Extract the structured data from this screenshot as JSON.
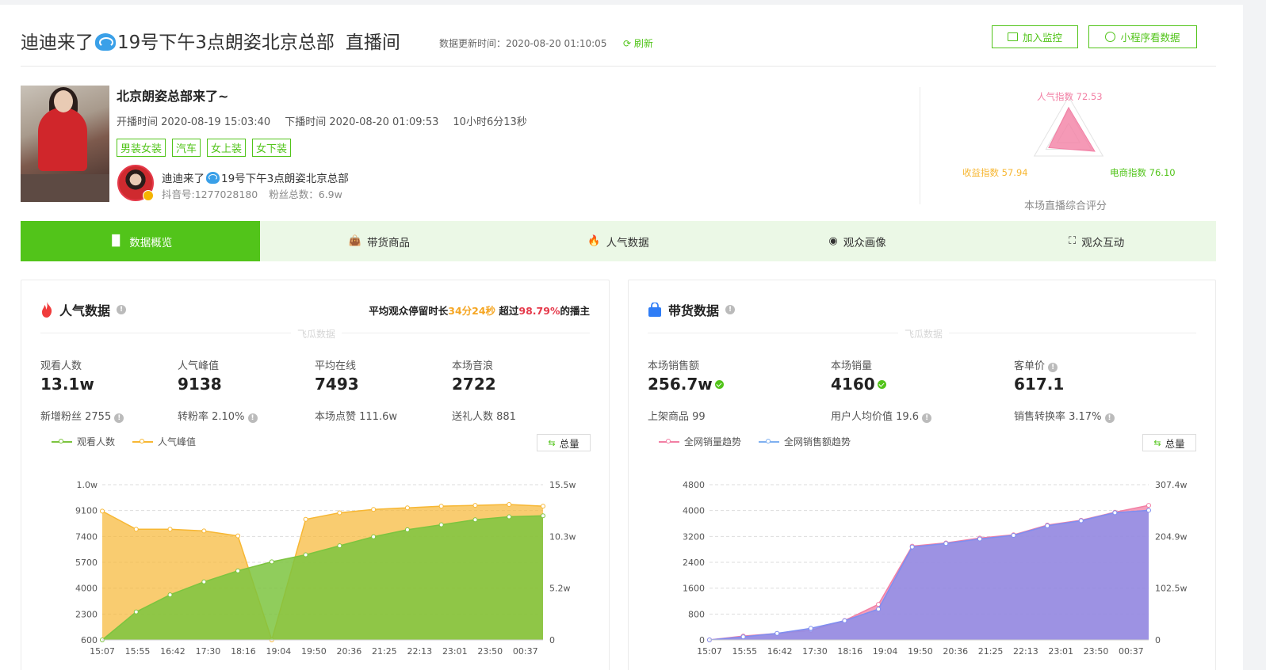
{
  "header": {
    "title_prefix": "迪迪来了",
    "title_suffix": "19号下午3点朗姿北京总部",
    "room_label": "直播间",
    "update_time": "数据更新时间：2020-08-20 01:10:05",
    "refresh_label": "刷新",
    "monitor_button": "加入监控",
    "miniapp_button": "小程序看数据"
  },
  "profile": {
    "live_title": "北京朗姿总部来了~",
    "start_time": "开播时间 2020-08-19 15:03:40",
    "end_time": "下播时间 2020-08-20 01:09:53",
    "duration": "10小时6分13秒",
    "tags": [
      "男装女装",
      "汽车",
      "女上装",
      "女下装"
    ],
    "anchor_name_prefix": "迪迪来了",
    "anchor_name_suffix": "19号下午3点朗姿北京总部",
    "douyin_id": "抖音号:1277028180",
    "fans": "粉丝总数：6.9w"
  },
  "score": {
    "popularity": "人气指数 72.53",
    "revenue": "收益指数 57.94",
    "ecommerce": "电商指数 76.10",
    "caption": "本场直播综合评分",
    "values": {
      "popularity": 72.53,
      "revenue": 57.94,
      "ecommerce": 76.1
    }
  },
  "tabs": [
    {
      "label": "数据概览",
      "icon": "bar-chart-icon",
      "active": true
    },
    {
      "label": "带货商品",
      "icon": "shopping-bag-icon",
      "active": false
    },
    {
      "label": "人气数据",
      "icon": "flame-icon",
      "active": false
    },
    {
      "label": "观众画像",
      "icon": "pulse-icon",
      "active": false
    },
    {
      "label": "观众互动",
      "icon": "interaction-icon",
      "active": false
    }
  ],
  "popularity": {
    "title": "人气数据",
    "stay_prefix": "平均观众停留时长",
    "stay_value": "34分24秒",
    "stay_mid": " 超过",
    "stay_percent": "98.79%",
    "stay_suffix": "的播主",
    "watermark": "飞瓜数据",
    "stats": [
      {
        "label": "观看人数",
        "value": "13.1w",
        "sub": "新增粉丝 2755"
      },
      {
        "label": "人气峰值",
        "value": "9138",
        "sub": "转粉率 2.10%"
      },
      {
        "label": "平均在线",
        "value": "7493",
        "sub": "本场点赞 111.6w"
      },
      {
        "label": "本场音浪",
        "value": "2722",
        "sub": "送礼人数 881"
      }
    ],
    "legend": [
      "观看人数",
      "人气峰值"
    ],
    "total_button": "总量"
  },
  "sales": {
    "title": "带货数据",
    "watermark": "飞瓜数据",
    "stats": [
      {
        "label": "本场销售额",
        "value": "256.7w",
        "sub": "上架商品 99"
      },
      {
        "label": "本场销量",
        "value": "4160",
        "sub": "用户人均价值 19.6"
      },
      {
        "label": "客单价",
        "value": "617.1",
        "sub": "销售转换率 3.17%"
      }
    ],
    "legend": [
      "全网销量趋势",
      "全网销售额趋势"
    ],
    "total_button": "总量"
  },
  "colors": {
    "accent": "#52c41a",
    "green_series": "#7cc43f",
    "orange_series": "#f7b733",
    "pink_series": "#f27fa4",
    "blue_series": "#7f8ef0"
  },
  "chart_data": [
    {
      "type": "area",
      "x": [
        "15:07",
        "15:55",
        "16:42",
        "17:30",
        "18:16",
        "19:04",
        "19:50",
        "20:36",
        "21:25",
        "22:13",
        "23:01",
        "23:50",
        "00:37"
      ],
      "left_axis_ticks": [
        "600",
        "2300",
        "4000",
        "5700",
        "7400",
        "9100",
        "1.0w"
      ],
      "right_axis_ticks": [
        "0",
        "5.2w",
        "10.3w",
        "15.5w"
      ],
      "ylim_left": [
        600,
        10000
      ],
      "ylim_right": [
        0,
        155000
      ],
      "series": [
        {
          "name": "观看人数",
          "axis": "right",
          "values": [
            0,
            28000,
            45000,
            58000,
            69000,
            78000,
            85000,
            94000,
            103000,
            110000,
            115000,
            120000,
            123000,
            124000
          ]
        },
        {
          "name": "人气峰值",
          "axis": "left",
          "values": [
            8400,
            7300,
            7300,
            7200,
            6900,
            600,
            7900,
            8300,
            8500,
            8600,
            8700,
            8750,
            8800,
            8700
          ]
        }
      ]
    },
    {
      "type": "area",
      "x": [
        "15:07",
        "15:55",
        "16:42",
        "17:30",
        "18:16",
        "19:04",
        "19:50",
        "20:36",
        "21:25",
        "22:13",
        "23:01",
        "23:50",
        "00:37"
      ],
      "left_axis_ticks": [
        "0",
        "800",
        "1600",
        "2400",
        "3200",
        "4000",
        "4800"
      ],
      "right_axis_ticks": [
        "0",
        "102.5w",
        "204.9w",
        "307.4w"
      ],
      "ylim_left": [
        0,
        4800
      ],
      "ylim_right": [
        0,
        3074000
      ],
      "series": [
        {
          "name": "全网销量趋势",
          "axis": "left",
          "values": [
            0,
            120,
            200,
            300,
            600,
            1100,
            2900,
            3000,
            3150,
            3250,
            3550,
            3700,
            3950,
            4160
          ]
        },
        {
          "name": "全网销售额趋势",
          "axis": "right",
          "values": [
            0,
            60000,
            130000,
            230000,
            380000,
            610000,
            1840000,
            1910000,
            2000000,
            2070000,
            2260000,
            2360000,
            2520000,
            2567000
          ]
        }
      ]
    }
  ]
}
